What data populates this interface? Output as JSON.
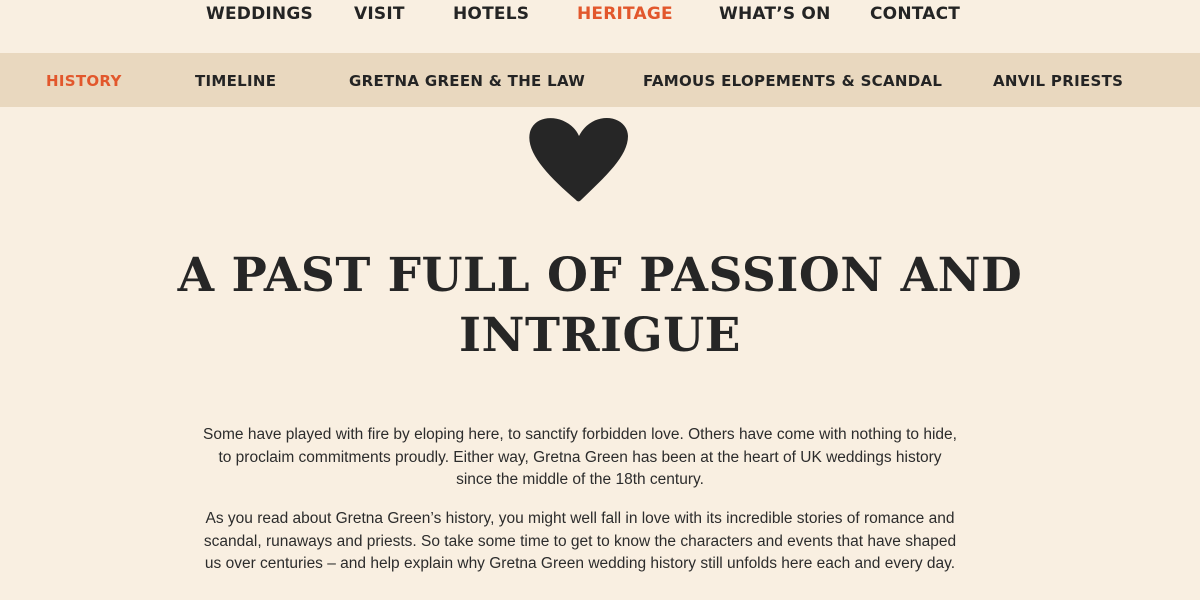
{
  "top_nav": {
    "items": [
      {
        "label": "WEDDINGS",
        "active": false
      },
      {
        "label": "VISIT",
        "active": false
      },
      {
        "label": "HOTELS",
        "active": false
      },
      {
        "label": "HERITAGE",
        "active": true
      },
      {
        "label": "WHAT’S ON",
        "active": false
      },
      {
        "label": "CONTACT",
        "active": false
      }
    ]
  },
  "sub_nav": {
    "items": [
      {
        "label": "HISTORY",
        "active": true
      },
      {
        "label": "TIMELINE",
        "active": false
      },
      {
        "label": "GRETNA GREEN & THE LAW",
        "active": false
      },
      {
        "label": "FAMOUS ELOPEMENTS & SCANDAL",
        "active": false
      },
      {
        "label": "ANVIL PRIESTS",
        "active": false
      }
    ]
  },
  "hero": {
    "icon": "heart-icon",
    "headline": "A PAST FULL OF PASSION AND INTRIGUE"
  },
  "intro": {
    "paragraph_1": "Some have played with fire by eloping here, to sanctify forbidden love. Others have come with nothing to hide, to proclaim commitments proudly. Either way, Gretna Green has been at the heart of UK weddings history since the middle of the 18th century.",
    "paragraph_2": "As you read about Gretna Green’s history, you might well fall in love with its incredible stories of romance and scandal, runaways and priests. So take some time to get to know the characters and events that have shaped us over centuries – and help explain why Gretna Green wedding history still unfolds here each and every day."
  },
  "colors": {
    "background": "#f9efe1",
    "sub_nav_background": "#e9d8bf",
    "accent": "#e2572c",
    "text": "#242424"
  }
}
